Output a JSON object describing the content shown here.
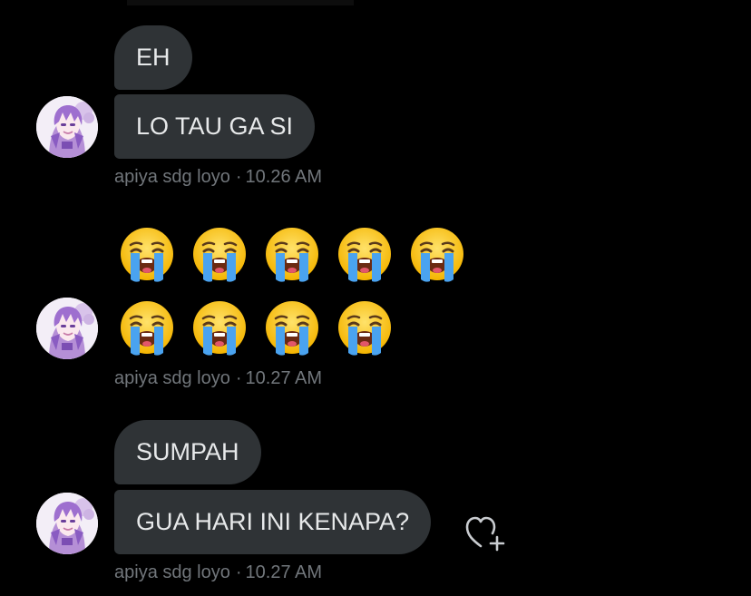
{
  "conversation": {
    "groups": [
      {
        "messages": [
          "EH",
          "LO TAU GA SI"
        ],
        "sender": "apiya sdg loyo",
        "time": "10.26 AM"
      },
      {
        "emoji_rows": [
          [
            "loudly-crying-face",
            "loudly-crying-face",
            "loudly-crying-face",
            "loudly-crying-face",
            "loudly-crying-face"
          ],
          [
            "loudly-crying-face",
            "loudly-crying-face",
            "loudly-crying-face",
            "loudly-crying-face"
          ]
        ],
        "sender": "apiya sdg loyo",
        "time": "10.27 AM"
      },
      {
        "messages": [
          "SUMPAH",
          "GUA HARI INI KENAPA?"
        ],
        "sender": "apiya sdg loyo",
        "time": "10.27 AM"
      }
    ],
    "meta_separator": "·",
    "icons": {
      "avatar": "avatar-image",
      "react": "heart-plus-icon"
    }
  },
  "colors": {
    "background": "#000000",
    "bubble": "#2f3336",
    "bubble_text": "#e7e9ea",
    "meta_text": "#71767b"
  }
}
